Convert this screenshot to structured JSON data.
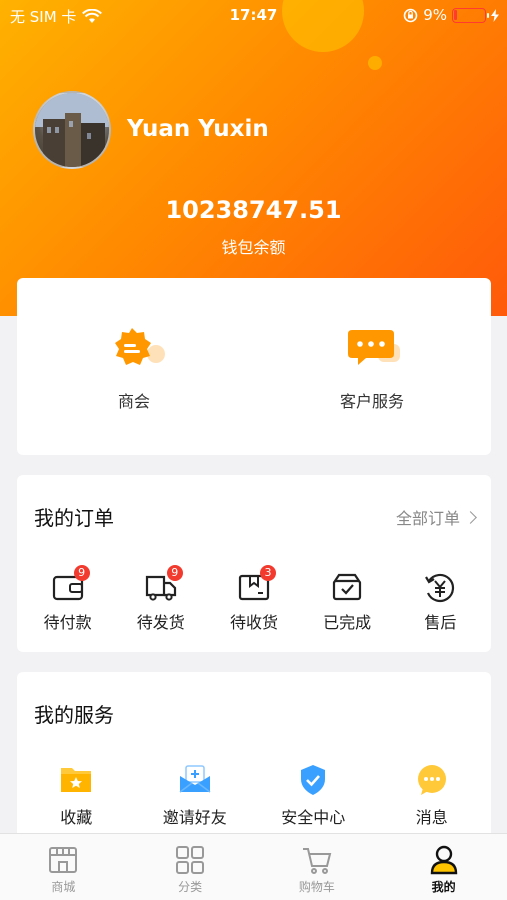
{
  "status_bar": {
    "carrier": "无 SIM 卡",
    "time": "17:47",
    "battery": "9%"
  },
  "profile": {
    "name": "Yuan Yuxin",
    "balance": "10238747.51",
    "balance_label": "钱包余额"
  },
  "quick_links": [
    {
      "label": "商会",
      "icon": "badge-icon"
    },
    {
      "label": "客户服务",
      "icon": "chat-bubble-icon"
    }
  ],
  "orders": {
    "title": "我的订单",
    "all_link": "全部订单",
    "items": [
      {
        "label": "待付款",
        "icon": "wallet-icon",
        "badge": "9"
      },
      {
        "label": "待发货",
        "icon": "truck-icon",
        "badge": "9"
      },
      {
        "label": "待收货",
        "icon": "package-icon",
        "badge": "3"
      },
      {
        "label": "已完成",
        "icon": "box-check-icon",
        "badge": ""
      },
      {
        "label": "售后",
        "icon": "yuan-refund-icon",
        "badge": ""
      }
    ]
  },
  "services": {
    "title": "我的服务",
    "items": [
      {
        "label": "收藏",
        "icon": "folder-star-icon"
      },
      {
        "label": "邀请好友",
        "icon": "invite-envelope-icon"
      },
      {
        "label": "安全中心",
        "icon": "shield-check-icon"
      },
      {
        "label": "消息",
        "icon": "message-icon"
      }
    ]
  },
  "tabbar": {
    "items": [
      {
        "label": "商城",
        "icon": "store-icon"
      },
      {
        "label": "分类",
        "icon": "grid-icon"
      },
      {
        "label": "购物车",
        "icon": "cart-icon"
      },
      {
        "label": "我的",
        "icon": "user-icon",
        "active": true
      }
    ]
  },
  "colors": {
    "accent": "#ff8a00",
    "badge": "#f23b2e"
  }
}
